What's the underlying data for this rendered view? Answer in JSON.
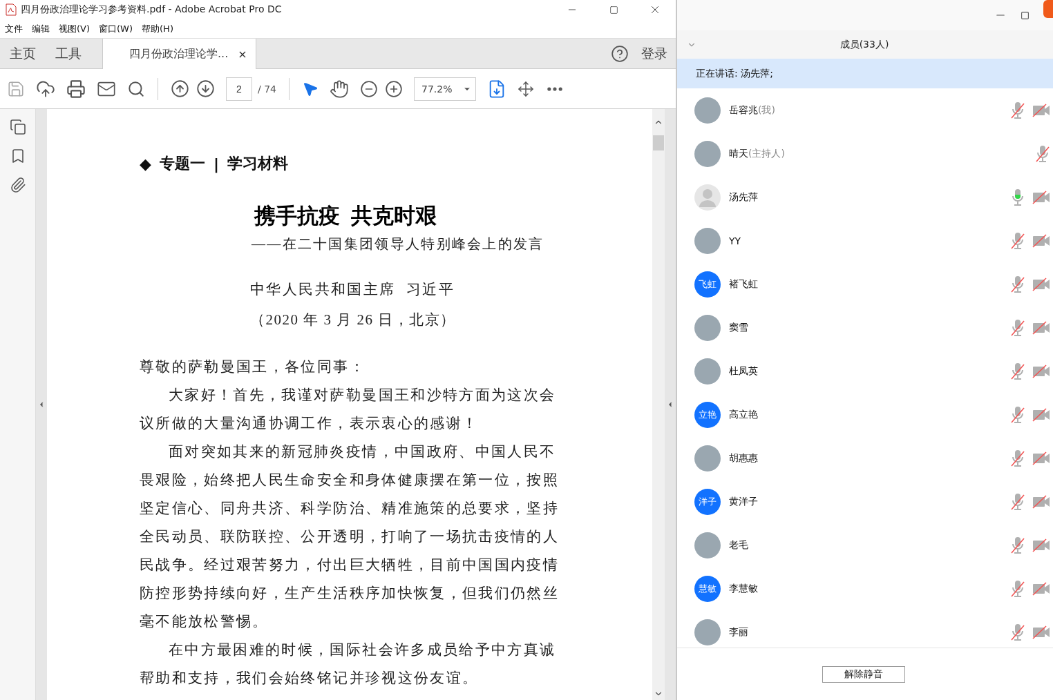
{
  "window": {
    "title": "四月份政治理论学习参考资料.pdf - Adobe Acrobat Pro DC"
  },
  "menu": [
    "文件",
    "编辑",
    "视图(V)",
    "窗口(W)",
    "帮助(H)"
  ],
  "tabs": [
    {
      "label": "主页",
      "selected": false,
      "kind": "nav"
    },
    {
      "label": "工具",
      "selected": false,
      "kind": "nav"
    },
    {
      "label": "四月份政治理论学...",
      "selected": true,
      "kind": "document",
      "close": "×"
    }
  ],
  "sign_in": "登录",
  "toolbar": {
    "page": "2",
    "page_total": "/ 74",
    "zoom": "77.2%"
  },
  "document": {
    "heading": {
      "marker": "◆",
      "label": "专题一",
      "separator": "|",
      "topic": "学习材料"
    },
    "title": "携手抗疫  共克时艰",
    "subtitle": "——在二十国集团领导人特别峰会上的发言",
    "author": "中华人民共和国主席  习近平",
    "date": "（2020 年 3 月 26 日，北京）",
    "salutation": "尊敬的萨勒曼国王，各位同事：",
    "paragraphs": [
      "大家好！首先，我谨对萨勒曼国王和沙特方面为这次会议所做的大量沟通协调工作，表示衷心的感谢！",
      "面对突如其来的新冠肺炎疫情，中国政府、中国人民不畏艰险，始终把人民生命安全和身体健康摆在第一位，按照坚定信心、同舟共济、科学防治、精准施策的总要求，坚持全民动员、联防联控、公开透明，打响了一场抗击疫情的人民战争。经过艰苦努力，付出巨大牺牲，目前中国国内疫情防控形势持续向好，生产生活秩序加快恢复，但我们仍然丝毫不能放松警惕。",
      "在中方最困难的时候，国际社会许多成员给予中方真诚帮助和支持，我们会始终铭记并珍视这份友谊。"
    ]
  },
  "members_panel": {
    "title": "成员(33人)",
    "speaking": "正在讲话: 汤先萍;",
    "members": [
      {
        "name": "岳容兆",
        "role": "(我)",
        "avatar": {
          "kind": "photo"
        },
        "muted": true,
        "camera": true
      },
      {
        "name": "晴天",
        "role": "(主持人)",
        "avatar": {
          "kind": "photo"
        },
        "muted": true,
        "camera": false
      },
      {
        "name": "汤先萍",
        "avatar": {
          "kind": "default"
        },
        "muted": false,
        "camera": true
      },
      {
        "name": "YY",
        "avatar": {
          "kind": "photo"
        },
        "muted": true,
        "camera": true
      },
      {
        "name": "褚飞虹",
        "avatar": {
          "kind": "initials",
          "text": "飞虹"
        },
        "muted": true,
        "camera": true
      },
      {
        "name": "窦雪",
        "avatar": {
          "kind": "photo"
        },
        "muted": true,
        "camera": true
      },
      {
        "name": "杜凤英",
        "avatar": {
          "kind": "photo"
        },
        "muted": true,
        "camera": true
      },
      {
        "name": "高立艳",
        "avatar": {
          "kind": "initials",
          "text": "立艳"
        },
        "muted": true,
        "camera": true
      },
      {
        "name": "胡惠惠",
        "avatar": {
          "kind": "photo"
        },
        "muted": true,
        "camera": true
      },
      {
        "name": "黄洋子",
        "avatar": {
          "kind": "initials",
          "text": "洋子"
        },
        "muted": true,
        "camera": true
      },
      {
        "name": "老毛",
        "avatar": {
          "kind": "photo"
        },
        "muted": true,
        "camera": true
      },
      {
        "name": "李慧敏",
        "avatar": {
          "kind": "initials",
          "text": "慧敏"
        },
        "muted": true,
        "camera": true
      },
      {
        "name": "李丽",
        "avatar": {
          "kind": "photo"
        },
        "muted": true,
        "camera": true
      }
    ],
    "unmute_button": "解除静音"
  }
}
